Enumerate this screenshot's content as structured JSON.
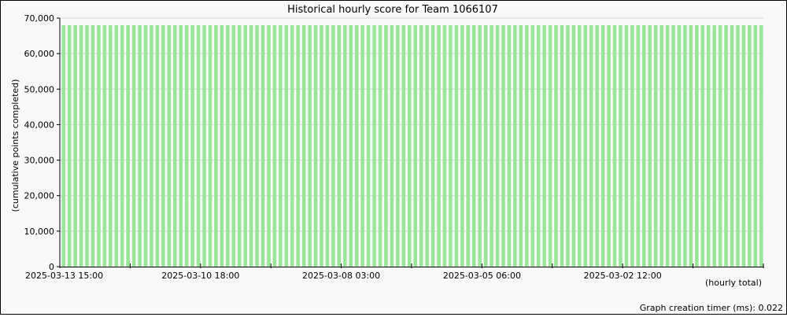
{
  "chart_data": {
    "type": "bar",
    "title": "Historical hourly score for Team 1066107",
    "xlabel": "(hourly total)",
    "ylabel": "(cumulative points completed)",
    "ylim": [
      0,
      70000
    ],
    "yticks": [
      {
        "value": 0,
        "label": "0"
      },
      {
        "value": 10000,
        "label": "10,000"
      },
      {
        "value": 20000,
        "label": "20,000"
      },
      {
        "value": 30000,
        "label": "30,000"
      },
      {
        "value": 40000,
        "label": "40,000"
      },
      {
        "value": 50000,
        "label": "50,000"
      },
      {
        "value": 60000,
        "label": "60,000"
      },
      {
        "value": 70000,
        "label": "70,000"
      }
    ],
    "xtick_labels": [
      "2025-03-13 15:00",
      "2025-03-10 18:00",
      "2025-03-08 03:00",
      "2025-03-05 06:00",
      "2025-03-02 12:00"
    ],
    "bar_count": 120,
    "bar_value": 68000,
    "grid": true,
    "bar_color": "#99e699",
    "footer": "Graph creation timer (ms): 0.022"
  }
}
